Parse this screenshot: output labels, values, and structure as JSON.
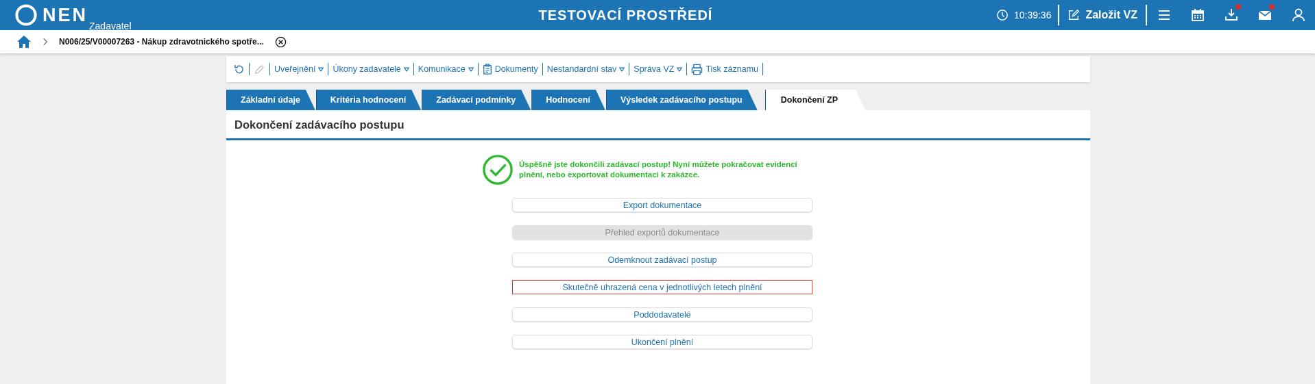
{
  "header": {
    "logo": "NEN",
    "subtitle": "Zadavatel",
    "environment": "TESTOVACÍ PROSTŘEDÍ",
    "time": "10:39:36",
    "create_button": "Založit VZ",
    "icons": [
      {
        "kind": "menu",
        "badge": false
      },
      {
        "kind": "calendar",
        "badge": false
      },
      {
        "kind": "download",
        "badge": true
      },
      {
        "kind": "mail",
        "badge": true
      },
      {
        "kind": "user",
        "badge": false
      }
    ]
  },
  "breadcrumb": {
    "item": "N006/25/V00007263 - Nákup zdravotnického spotře..."
  },
  "toolbar": [
    {
      "kind": "refresh",
      "disabled": false
    },
    {
      "kind": "edit",
      "disabled": true
    },
    {
      "kind": "menu",
      "label": "Uveřejnění",
      "dropdown": true
    },
    {
      "kind": "menu",
      "label": "Úkony zadavatele",
      "dropdown": true
    },
    {
      "kind": "menu",
      "label": "Komunikace",
      "dropdown": true
    },
    {
      "kind": "documents",
      "label": "Dokumenty",
      "dropdown": false
    },
    {
      "kind": "menu",
      "label": "Nestandardní stav",
      "dropdown": true
    },
    {
      "kind": "menu",
      "label": "Správa VZ",
      "dropdown": true
    },
    {
      "kind": "print",
      "label": "Tisk záznamu",
      "dropdown": false
    }
  ],
  "tabs": [
    {
      "label": "Základní údaje",
      "selected": false
    },
    {
      "label": "Kritéria hodnocení",
      "selected": false
    },
    {
      "label": "Zadávací podmínky",
      "selected": false
    },
    {
      "label": "Hodnocení",
      "selected": false
    },
    {
      "label": "Výsledek zadávacího postupu",
      "selected": false
    },
    {
      "label": "Dokončení ZP",
      "selected": true
    }
  ],
  "section_title": "Dokončení zadávacího postupu",
  "success_message": "Úspěšně jste dokončili zadávací postup! Nyní můžete pokračovat evidencí plnění, nebo exportovat dokumentaci k zakázce.",
  "actions": [
    {
      "label": "Export dokumentace",
      "disabled": false,
      "highlighted": false
    },
    {
      "label": "Přehled exportů dokumentace",
      "disabled": true,
      "highlighted": false
    },
    {
      "label": "Odemknout zadávací postup",
      "disabled": false,
      "highlighted": false
    },
    {
      "label": "Skutečně uhrazená cena v jednotlivých letech plnění",
      "disabled": false,
      "highlighted": true
    },
    {
      "label": "Poddodavatelé",
      "disabled": false,
      "highlighted": false
    },
    {
      "label": "Ukončení plnění",
      "disabled": false,
      "highlighted": false
    }
  ]
}
